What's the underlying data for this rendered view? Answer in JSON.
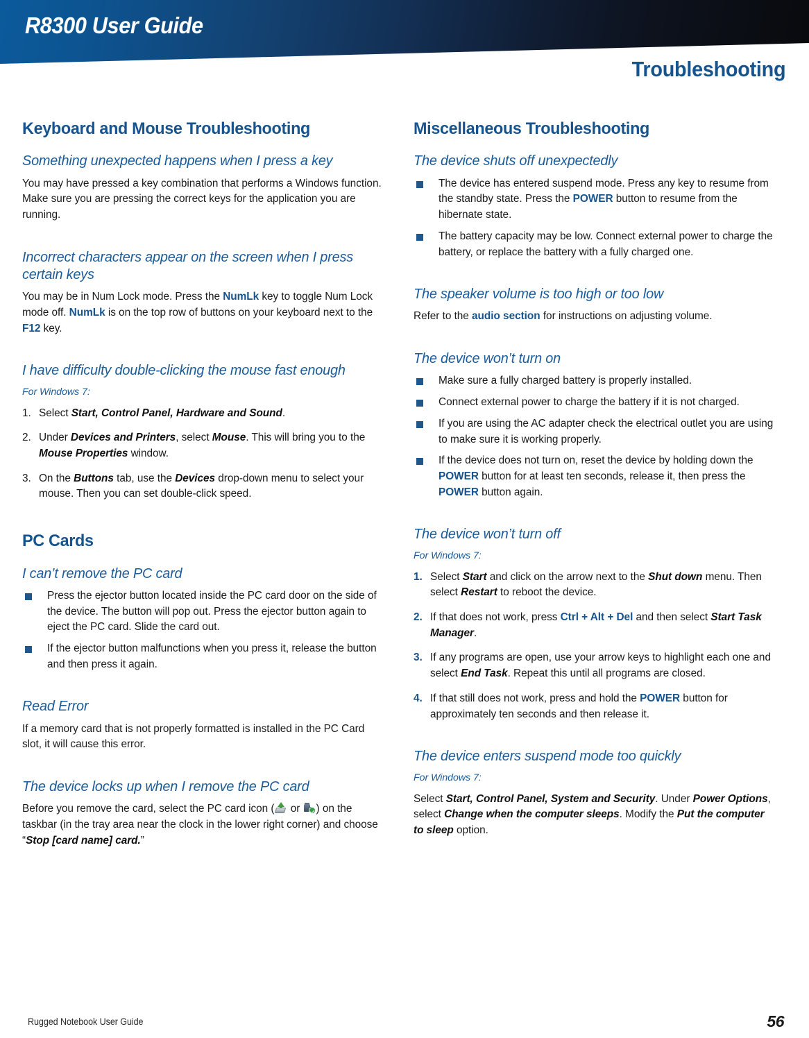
{
  "header": {
    "guide_title": "R8300 User Guide",
    "chapter_title": "Troubleshooting",
    "banner_color_left": "#0b5a9b",
    "banner_color_right": "#090a0d",
    "accent_blue": "#17548e"
  },
  "left_column": {
    "section1_heading": "Keyboard and Mouse Troubleshooting",
    "sub1_heading": "Something unexpected happens when I press a key",
    "sub1_body_1": "You may have pressed a key combination that performs a ",
    "sub1_body_2": "Windows function. Make sure you are pressing the correct keys for the application you are running.",
    "sub2_heading": "Incorrect characters appear on the screen when I press certain keys",
    "sub2_body_a": "You may be in Num Lock mode. Press the ",
    "sub2_key1": "NumLk",
    "sub2_body_b": " key to toggle Num Lock mode off. ",
    "sub2_key2": "NumLk",
    "sub2_body_c": " is on the top row of buttons on your keyboard next to the ",
    "sub2_key3": "F12",
    "sub2_body_d": " key.",
    "sub3_heading": "I have difficulty double-clicking the mouse fast enough",
    "sub3_forwin": "For Windows 7:",
    "sub3_steps": [
      {
        "num": "1.",
        "parts": [
          {
            "t": "Select ",
            "s": "plain"
          },
          {
            "t": "Start, Control Panel, Hardware and Sound",
            "s": "ui"
          },
          {
            "t": ".",
            "s": "plain"
          }
        ]
      },
      {
        "num": "2.",
        "parts": [
          {
            "t": "Under ",
            "s": "plain"
          },
          {
            "t": "Devices and Printers",
            "s": "ui"
          },
          {
            "t": ", select ",
            "s": "plain"
          },
          {
            "t": "Mouse",
            "s": "ui"
          },
          {
            "t": ". This will bring you to the ",
            "s": "plain"
          },
          {
            "t": "Mouse Properties",
            "s": "ui"
          },
          {
            "t": " window.",
            "s": "plain"
          }
        ]
      },
      {
        "num": "3.",
        "parts": [
          {
            "t": "On the ",
            "s": "plain"
          },
          {
            "t": "Buttons",
            "s": "ui"
          },
          {
            "t": " tab, use the ",
            "s": "plain"
          },
          {
            "t": "Devices",
            "s": "ui"
          },
          {
            "t": " drop-down menu to select your mouse. Then you can set double-click speed.",
            "s": "plain"
          }
        ]
      }
    ],
    "section2_heading": "PC Cards",
    "sub4_heading": "I can’t remove the PC card",
    "sub4_bullets": [
      "Press the ejector button located inside the PC card door on the side of the device. The button will pop out. Press the ejector button again to eject the PC card. Slide the card out.",
      "If the ejector button malfunctions when you press it, release the button and then press it again."
    ],
    "sub5_heading": "Read Error",
    "sub5_body": "If a memory card that is not properly formatted is installed in the PC Card slot, it will cause this error.",
    "sub6_heading": "The device locks up when I remove the PC card",
    "sub6_body_a": "Before you remove the card, select the PC card icon (",
    "sub6_icon1_name": "pc-card-eject-icon",
    "sub6_body_b": " or ",
    "sub6_icon2_name": "usb-safe-remove-icon",
    "sub6_body_c": ") on the taskbar (in the tray area near the clock in the lower right corner) and choose “",
    "sub6_body_ui": "Stop [card name] card.",
    "sub6_body_d": "”"
  },
  "right_column": {
    "section1_heading": "Miscellaneous Troubleshooting",
    "sub1_heading": "The device shuts off unexpectedly",
    "sub1_bullet1_a": "The device has entered suspend mode. Press any key to resume from the standby state. Press the ",
    "sub1_bullet1_key": "POWER",
    "sub1_bullet1_b": " button to resume from the hibernate state.",
    "sub1_bullet2": "The battery capacity may be low. Connect external power to charge the battery, or replace the battery with a fully charged one.",
    "sub2_heading": "The speaker volume is too high or too low",
    "sub2_body_a": "Refer to the ",
    "sub2_xref": "audio section",
    "sub2_body_b": " for instructions on adjusting volume.",
    "sub3_heading": "The device won’t turn on",
    "sub3_bullet1": "Make sure a fully charged battery is properly installed.",
    "sub3_bullet2": "Connect external power to charge the battery if it is not charged.",
    "sub3_bullet3": "If you are using the AC adapter check the electrical outlet you are using to make sure it is working properly.",
    "sub3_bullet4_a": "If the device does not turn on, reset the device by holding down the ",
    "sub3_bullet4_key1": "POWER",
    "sub3_bullet4_b": " button for at least ten seconds, release it, then press the ",
    "sub3_bullet4_key2": "POWER",
    "sub3_bullet4_c": " button again.",
    "sub4_heading": "The device won’t turn off",
    "sub4_forwin": "For Windows 7:",
    "sub4_steps": [
      {
        "num": "1.",
        "parts": [
          {
            "t": "Select ",
            "s": "plain"
          },
          {
            "t": "Start",
            "s": "ui"
          },
          {
            "t": " and click on the arrow next to the ",
            "s": "plain"
          },
          {
            "t": "Shut down",
            "s": "ui"
          },
          {
            "t": " menu. Then select ",
            "s": "plain"
          },
          {
            "t": "Restart",
            "s": "ui"
          },
          {
            "t": " to reboot the device.",
            "s": "plain"
          }
        ]
      },
      {
        "num": "2.",
        "parts": [
          {
            "t": "If that does not work, press ",
            "s": "plain"
          },
          {
            "t": "Ctrl + Alt + Del",
            "s": "key"
          },
          {
            "t": " and then select ",
            "s": "plain"
          },
          {
            "t": "Start Task Manager",
            "s": "ui"
          },
          {
            "t": ".",
            "s": "plain"
          }
        ]
      },
      {
        "num": "3.",
        "parts": [
          {
            "t": "If any programs are open, use your arrow keys to highlight each one and select ",
            "s": "plain"
          },
          {
            "t": "End Task",
            "s": "ui"
          },
          {
            "t": ". Repeat this until all programs are closed.",
            "s": "plain"
          }
        ]
      },
      {
        "num": "4.",
        "parts": [
          {
            "t": "If that still does not work, press and hold the ",
            "s": "plain"
          },
          {
            "t": "POWER",
            "s": "key"
          },
          {
            "t": " button for approximately ten seconds and then release it.",
            "s": "plain"
          }
        ]
      }
    ],
    "sub5_heading": "The device enters suspend mode too quickly",
    "sub5_forwin": "For Windows 7:",
    "sub5_parts": [
      {
        "t": "Select ",
        "s": "plain"
      },
      {
        "t": "Start, Control Panel, System and Security",
        "s": "ui"
      },
      {
        "t": ". Under ",
        "s": "plain"
      },
      {
        "t": "Power Options",
        "s": "ui"
      },
      {
        "t": ", select ",
        "s": "plain"
      },
      {
        "t": "Change when the computer sleeps",
        "s": "ui"
      },
      {
        "t": ". Modify the ",
        "s": "plain"
      },
      {
        "t": "Put the computer to sleep",
        "s": "ui"
      },
      {
        "t": " option.",
        "s": "plain"
      }
    ]
  },
  "footer": {
    "left_text": "Rugged Notebook User Guide",
    "page_number": "56"
  }
}
